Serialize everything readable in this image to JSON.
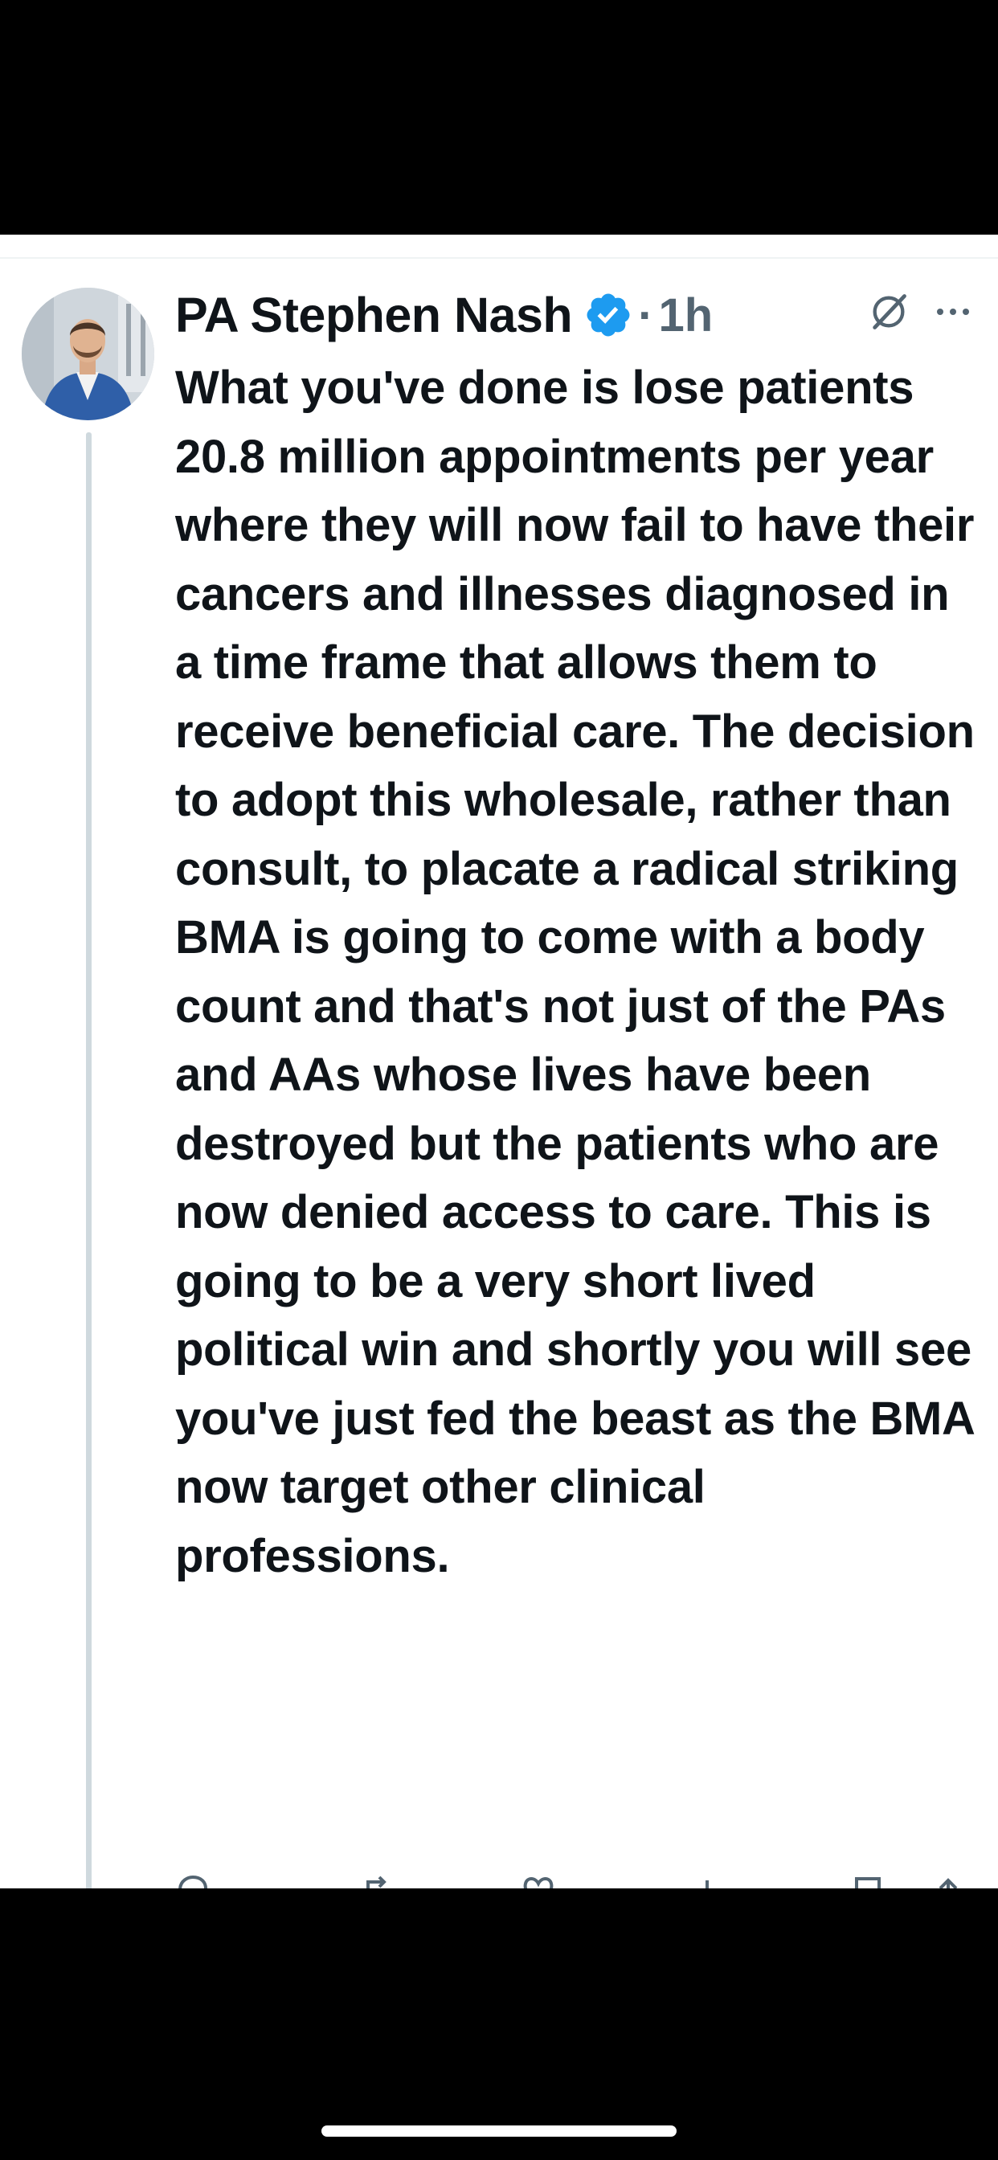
{
  "post": {
    "author_name": "PA Stephen Nash",
    "separator": "·",
    "timestamp": "1h",
    "verified_color": "#1d9bf0",
    "text": "What you've done is lose patients 20.8 million appointments per year where they will now fail to have their cancers and illnesses diagnosed in a time frame that allows them to receive beneficial care. The decision to adopt this wholesale, rather than consult, to placate a radical striking BMA is going to come with a body count and that's not just of the PAs and AAs whose lives have been destroyed but the patients who are now denied access to care. This is going to be a very short lived political win and shortly you will see you've just fed the beast as the BMA now target other clinical professions."
  },
  "icons": {
    "verified": "verified-badge-icon",
    "grok": "grok-icon",
    "more": "more-icon",
    "reply": "reply-icon",
    "repost": "repost-icon",
    "like": "like-icon",
    "views": "views-icon",
    "bookmark": "bookmark-icon",
    "share": "share-icon"
  },
  "colors": {
    "text_primary": "#0f1419",
    "text_secondary": "#536471",
    "thread_line": "#cfd9de"
  }
}
